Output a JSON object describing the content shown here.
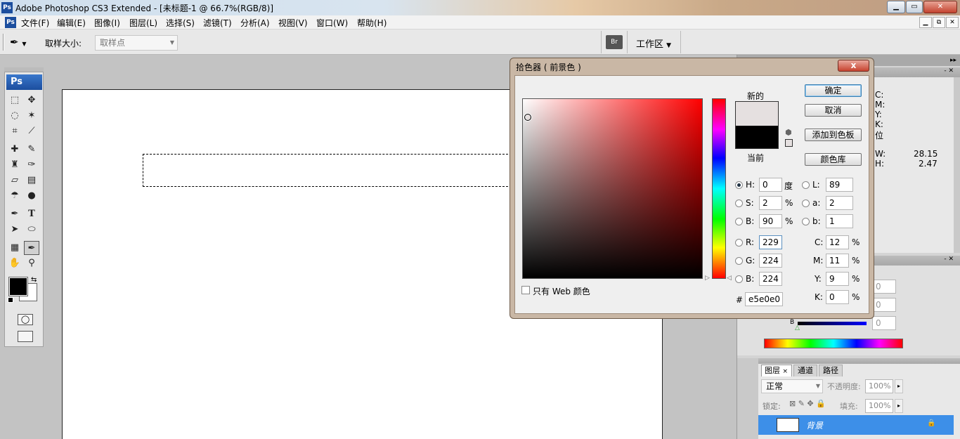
{
  "window": {
    "title": "Adobe Photoshop CS3 Extended - [未标题-1 @ 66.7%(RGB/8)]",
    "app_icon": "Ps",
    "controls": [
      "minimize-icon",
      "maximize-icon",
      "close-icon"
    ]
  },
  "menu": [
    "文件(F)",
    "编辑(E)",
    "图像(I)",
    "图层(L)",
    "选择(S)",
    "滤镜(T)",
    "分析(A)",
    "视图(V)",
    "窗口(W)",
    "帮助(H)"
  ],
  "options": {
    "sample_size_label": "取样大小:",
    "sample_size_value": "取样点",
    "workspace_label": "工作区"
  },
  "toolbox": {
    "logo": "Ps",
    "text_tool": "T"
  },
  "dialog": {
    "title": "拾色器 ( 前景色 )",
    "close": "x",
    "new_label": "新的",
    "current_label": "当前",
    "ok": "确定",
    "cancel": "取消",
    "add_swatch": "添加到色板",
    "libraries": "颜色库",
    "web_only": "只有 Web 颜色",
    "hash": "#",
    "hex": "e5e0e0",
    "new_color": "#e5e0e0",
    "current_color": "#000000",
    "fields": {
      "H": {
        "label": "H:",
        "value": "0",
        "unit": "度"
      },
      "S": {
        "label": "S:",
        "value": "2",
        "unit": "%"
      },
      "Bv": {
        "label": "B:",
        "value": "90",
        "unit": "%"
      },
      "R": {
        "label": "R:",
        "value": "229"
      },
      "G": {
        "label": "G:",
        "value": "224"
      },
      "Bl": {
        "label": "B:",
        "value": "224"
      },
      "L": {
        "label": "L:",
        "value": "89"
      },
      "a": {
        "label": "a:",
        "value": "2"
      },
      "b": {
        "label": "b:",
        "value": "1"
      },
      "C": {
        "label": "C:",
        "value": "12",
        "unit": "%"
      },
      "M": {
        "label": "M:",
        "value": "11",
        "unit": "%"
      },
      "Y": {
        "label": "Y:",
        "value": "9",
        "unit": "%"
      },
      "K": {
        "label": "K:",
        "value": "0",
        "unit": "%"
      }
    }
  },
  "info_panel": {
    "c": "C:",
    "m": "M:",
    "y": "Y:",
    "k": "K:",
    "bit": "位",
    "w": "W:",
    "w_val": "28.15",
    "h": "H:",
    "h_val": "2.47"
  },
  "color_panel": {
    "v1": "0",
    "v2": "0",
    "v3": "0",
    "b_label": "B"
  },
  "layers_panel": {
    "tabs": [
      "图层",
      "通道",
      "路径"
    ],
    "tab_close": "×",
    "blend_mode": "正常",
    "opacity_label": "不透明度:",
    "opacity_value": "100%",
    "lock_label": "锁定:",
    "fill_label": "填充:",
    "fill_value": "100%",
    "layer_name": "背景"
  }
}
